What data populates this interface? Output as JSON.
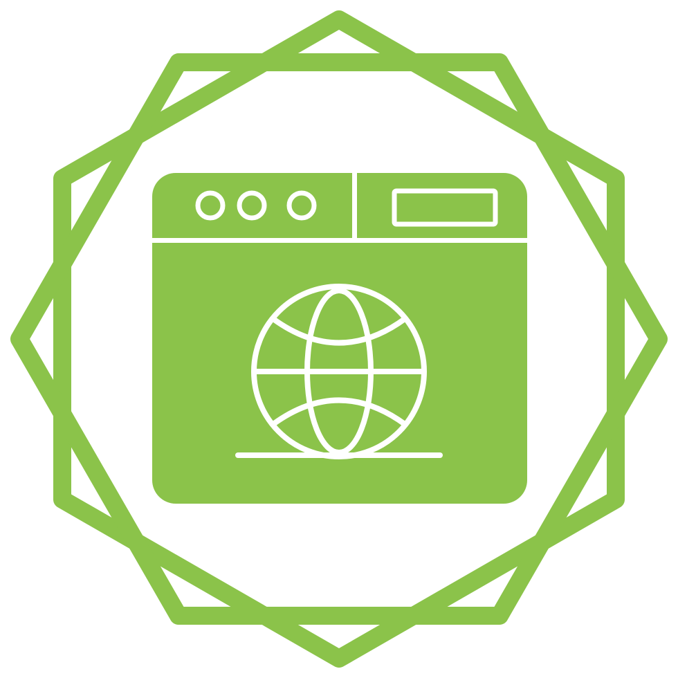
{
  "icon": {
    "name": "web-browser-globe-icon",
    "badge_frame": "scalloped-badge-frame",
    "color_primary": "#8bc34a",
    "color_background": "#ffffff"
  },
  "browser_window": {
    "title_bar_dots": [
      "circle",
      "circle",
      "circle"
    ],
    "address_bar": "empty-rectangle",
    "content_icon": "globe-icon"
  }
}
